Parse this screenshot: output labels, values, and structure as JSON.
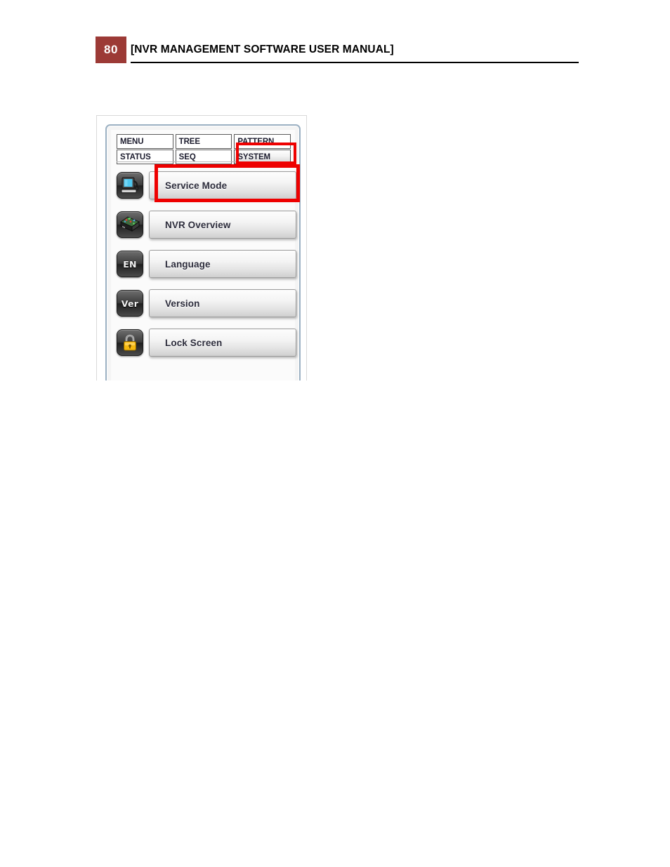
{
  "page": {
    "number": "80",
    "title": "[NVR MANAGEMENT SOFTWARE USER MANUAL]",
    "badge_color": "#9c3a36",
    "highlight_color": "#ee0000"
  },
  "app": {
    "tabs": [
      {
        "label": "MENU",
        "active": false
      },
      {
        "label": "TREE",
        "active": false
      },
      {
        "label": "PATTERN",
        "active": false
      },
      {
        "label": "STATUS",
        "active": false
      },
      {
        "label": "SEQ",
        "active": false
      },
      {
        "label": "SYSTEM",
        "active": true
      }
    ],
    "menu_items": [
      {
        "label": "Service Mode",
        "icon": "monitor-icon",
        "highlighted": true
      },
      {
        "label": "NVR Overview",
        "icon": "nvr-box-icon",
        "highlighted": false
      },
      {
        "label": "Language",
        "icon": "en-icon",
        "icon_text": "EN",
        "highlighted": false
      },
      {
        "label": "Version",
        "icon": "version-icon",
        "icon_text": "Ver",
        "highlighted": false
      },
      {
        "label": "Lock Screen",
        "icon": "padlock-icon",
        "highlighted": false
      }
    ]
  }
}
